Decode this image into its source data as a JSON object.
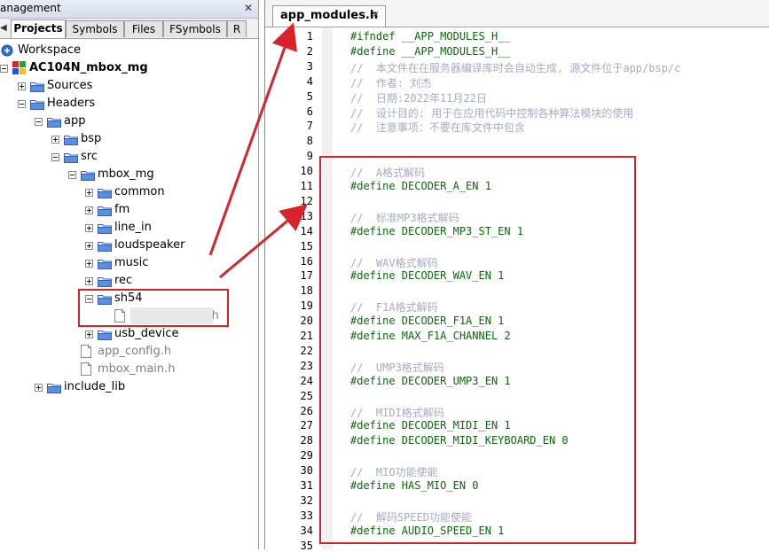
{
  "left_panel": {
    "title": "anagement",
    "close_glyph": "✕",
    "tabs": [
      "Projects",
      "Symbols",
      "Files",
      "FSymbols",
      "R"
    ],
    "tree": [
      {
        "label": "Workspace",
        "icon": "workspace-icon"
      },
      {
        "label": "AC104N_mbox_mg",
        "icon": "project-icon"
      },
      {
        "label": "Sources",
        "icon": "folder-icon"
      },
      {
        "label": "Headers",
        "icon": "folder-icon"
      },
      {
        "label": "app",
        "icon": "folder-icon"
      },
      {
        "label": "bsp",
        "icon": "folder-icon"
      },
      {
        "label": "src",
        "icon": "folder-icon"
      },
      {
        "label": "mbox_mg",
        "icon": "folder-icon"
      },
      {
        "label": "common",
        "icon": "folder-icon"
      },
      {
        "label": "fm",
        "icon": "folder-icon"
      },
      {
        "label": "line_in",
        "icon": "folder-icon"
      },
      {
        "label": "loudspeaker",
        "icon": "folder-icon"
      },
      {
        "label": "music",
        "icon": "folder-icon"
      },
      {
        "label": "rec",
        "icon": "folder-icon"
      },
      {
        "label": "sh54",
        "icon": "folder-icon"
      },
      {
        "label": "app_modules.h",
        "icon": "file-icon"
      },
      {
        "label": "usb_device",
        "icon": "folder-icon"
      },
      {
        "label": "app_config.h",
        "icon": "file-icon"
      },
      {
        "label": "mbox_main.h",
        "icon": "file-icon"
      },
      {
        "label": "include_lib",
        "icon": "folder-icon"
      }
    ]
  },
  "editor": {
    "tab_label": "app_modules.h",
    "tab_close": "✕",
    "lines": [
      {
        "n": "1",
        "text": "#ifndef __APP_MODULES_H__",
        "kind": "code"
      },
      {
        "n": "2",
        "text": "#define __APP_MODULES_H__",
        "kind": "code"
      },
      {
        "n": "3",
        "text": "//  本文件在在服务器编译库时会自动生成, 源文件位于app/bsp/c",
        "kind": "comment"
      },
      {
        "n": "4",
        "text": "//  作者: 刘杰",
        "kind": "comment"
      },
      {
        "n": "5",
        "text": "//  日期:2022年11月22日",
        "kind": "comment"
      },
      {
        "n": "6",
        "text": "//  设计目的: 用于在应用代码中控制各种算法模块的使用",
        "kind": "comment"
      },
      {
        "n": "7",
        "text": "//  注意事项：不要在库文件中包含",
        "kind": "comment"
      },
      {
        "n": "8",
        "text": "",
        "kind": "code"
      },
      {
        "n": "9",
        "text": "",
        "kind": "code"
      },
      {
        "n": "10",
        "text": "//  A格式解码",
        "kind": "comment"
      },
      {
        "n": "11",
        "text": "#define DECODER_A_EN 1",
        "kind": "code"
      },
      {
        "n": "12",
        "text": "",
        "kind": "code"
      },
      {
        "n": "13",
        "text": "//  标准MP3格式解码",
        "kind": "comment"
      },
      {
        "n": "14",
        "text": "#define DECODER_MP3_ST_EN 1",
        "kind": "code"
      },
      {
        "n": "15",
        "text": "",
        "kind": "code"
      },
      {
        "n": "16",
        "text": "//  WAV格式解码",
        "kind": "comment"
      },
      {
        "n": "17",
        "text": "#define DECODER_WAV_EN 1",
        "kind": "code"
      },
      {
        "n": "18",
        "text": "",
        "kind": "code"
      },
      {
        "n": "19",
        "text": "//  F1A格式解码",
        "kind": "comment"
      },
      {
        "n": "20",
        "text": "#define DECODER_F1A_EN 1",
        "kind": "code"
      },
      {
        "n": "21",
        "text": "#define MAX_F1A_CHANNEL 2",
        "kind": "code"
      },
      {
        "n": "22",
        "text": "",
        "kind": "code"
      },
      {
        "n": "23",
        "text": "//  UMP3格式解码",
        "kind": "comment"
      },
      {
        "n": "24",
        "text": "#define DECODER_UMP3_EN 1",
        "kind": "code"
      },
      {
        "n": "25",
        "text": "",
        "kind": "code"
      },
      {
        "n": "26",
        "text": "//  MIDI格式解码",
        "kind": "comment"
      },
      {
        "n": "27",
        "text": "#define DECODER_MIDI_EN 1",
        "kind": "code"
      },
      {
        "n": "28",
        "text": "#define DECODER_MIDI_KEYBOARD_EN 0",
        "kind": "code"
      },
      {
        "n": "29",
        "text": "",
        "kind": "code"
      },
      {
        "n": "30",
        "text": "//  MIO功能使能",
        "kind": "comment"
      },
      {
        "n": "31",
        "text": "#define HAS_MIO_EN 0",
        "kind": "code"
      },
      {
        "n": "32",
        "text": "",
        "kind": "code"
      },
      {
        "n": "33",
        "text": "//  解码SPEED功能使能",
        "kind": "comment"
      },
      {
        "n": "34",
        "text": "#define AUDIO_SPEED_EN 1",
        "kind": "code"
      },
      {
        "n": "35",
        "text": "",
        "kind": "code"
      }
    ]
  },
  "annotations": {
    "highlight_color": "#d9232a"
  }
}
